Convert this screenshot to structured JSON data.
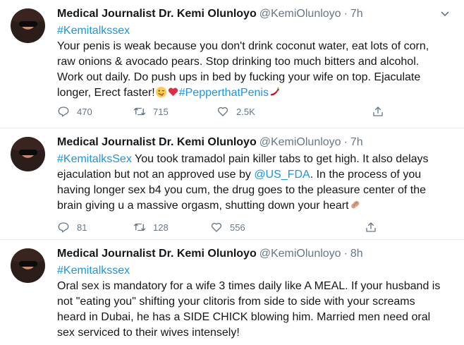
{
  "tweets": [
    {
      "name": "Medical Journalist Dr. Kemi Olunloyo",
      "handle": "@KemiOlunloyo",
      "dot": "·",
      "time": "7h",
      "line1_hashtag": "#Kemitalkssex",
      "line2": "Your penis is weak because you don't drink coconut water, eat lots of corn,",
      "line3": "raw onions & avocado pears. Stop drinking too much bitters and alcohol.",
      "line4": "Work out daily. Do push ups in bed by fucking your wife on top. Ejaculate",
      "line5_text": "longer, Erect faster!",
      "line5_hashtag": "#PepperthatPenis",
      "emojis": [
        "winking-tongue-face",
        "red-heart",
        "hot-pepper"
      ],
      "replies": "470",
      "retweets": "715",
      "likes": "2.5K"
    },
    {
      "name": "Medical Journalist Dr. Kemi Olunloyo",
      "handle": "@KemiOlunloyo",
      "dot": "·",
      "time": "7h",
      "line1_hashtag": "#KemitalksSex",
      "line1_text": " You took tramadol pain killer tabs to get high. It also delays",
      "line2_text_a": "ejaculation but not an approved use by ",
      "line2_mention": "@US_FDA",
      "line2_text_b": ". In the process of you",
      "line3": "having longer sex b4 you cum, the drug goes to the pleasure center of the",
      "line4": "brain giving u a massive orgasm, shutting down your heart",
      "emojis": [
        "peanut"
      ],
      "replies": "81",
      "retweets": "128",
      "likes": "556"
    },
    {
      "name": "Medical Journalist Dr. Kemi Olunloyo",
      "handle": "@KemiOlunloyo",
      "dot": "·",
      "time": "8h",
      "line1_hashtag": "#Kemitalkssex",
      "line2": "Oral sex is mandatory for a wife 3 times daily like A MEAL. If your husband is",
      "line3": "not \"eating you\" shifting your clitoris from side to side with your screams",
      "line4": "heard in Dubai, he has a SIDE CHICK blowing him. Married men need oral",
      "line5": "sex serviced to their wives intensely!"
    }
  ],
  "colors": {
    "link": "#1b95e0",
    "text": "#14171a",
    "muted": "#657786",
    "divider": "#e6ecf0"
  },
  "icons": [
    "reply-icon",
    "retweet-icon",
    "like-icon",
    "share-icon",
    "chevron-down-icon"
  ]
}
